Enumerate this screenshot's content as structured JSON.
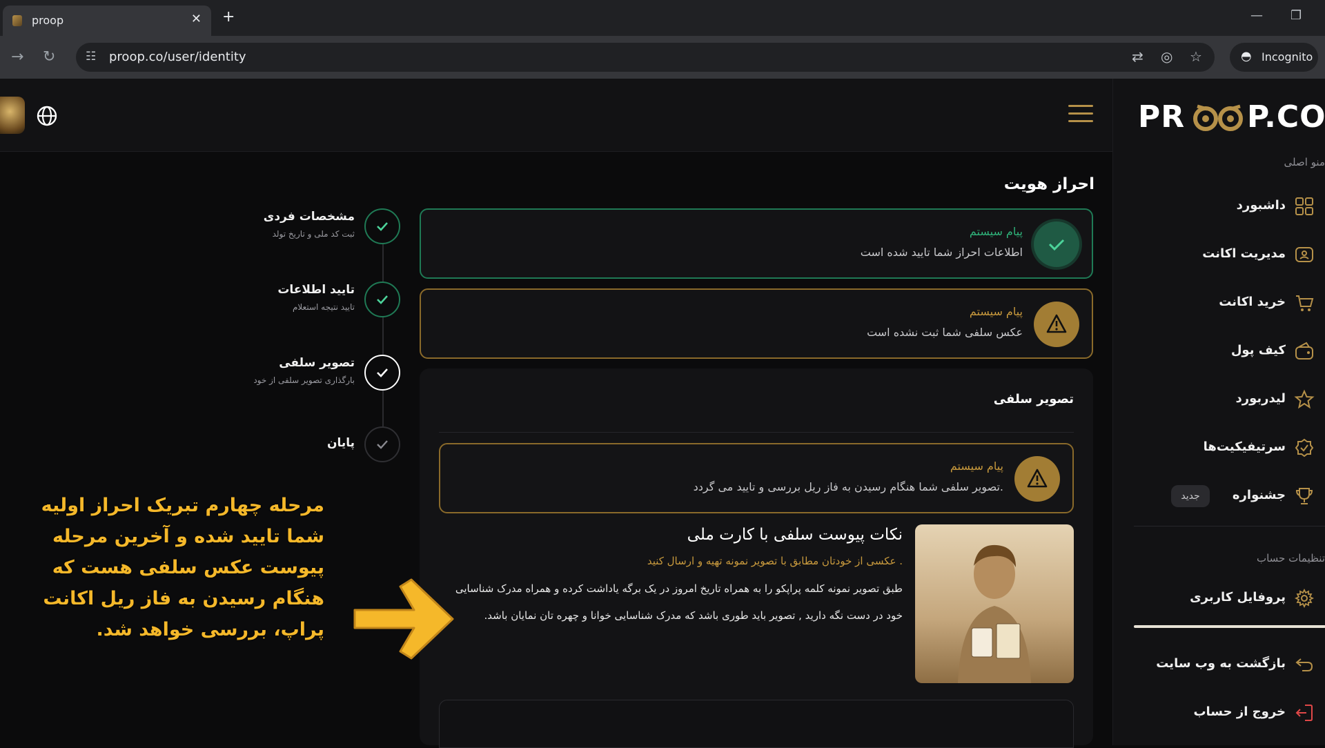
{
  "browser": {
    "tab_title": "proop",
    "tab_close": "✕",
    "new_tab": "+",
    "url": "proop.co/user/identity",
    "incognito_label": "Incognito"
  },
  "header": {
    "logo_left": "PR",
    "logo_right": "P.CO"
  },
  "sidebar": {
    "main_menu_label": "منو اصلی",
    "items": [
      {
        "label": "داشبورد",
        "icon": "grid-icon"
      },
      {
        "label": "مدیریت اکانت",
        "icon": "account-manage-icon"
      },
      {
        "label": "خرید اکانت",
        "icon": "cart-icon"
      },
      {
        "label": "کیف پول",
        "icon": "wallet-icon"
      },
      {
        "label": "لیدربورد",
        "icon": "star-icon"
      },
      {
        "label": "سرتیفیکیت‌ها",
        "icon": "certificate-icon"
      },
      {
        "label": "جشنواره",
        "icon": "trophy-icon",
        "badge": "جدید"
      }
    ],
    "account_settings_label": "تنظیمات حساب",
    "profile_label": "پروفایل کاربری",
    "back_label": "بازگشت به وب سایت",
    "logout_label": "خروج از حساب"
  },
  "main": {
    "page_title": "احراز هویت",
    "alerts": [
      {
        "title": "پیام سیستم",
        "text": "اطلاعات احراز شما تایید شده است",
        "status": "success"
      },
      {
        "title": "پیام سیستم",
        "text": "عکس سلفی شما ثبت نشده است",
        "status": "warning"
      }
    ],
    "selfie": {
      "card_title": "تصویر سلفی",
      "alert_title": "پیام سیستم",
      "alert_text": "تصویر سلفی شما هنگام رسیدن به فاز ریل بررسی و تایید می گردد.",
      "tips_title": "نکات پیوست سلفی با کارت ملی",
      "tips_subtitle": "عکسی از خودتان مطابق با تصویر نمونه تهیه و ارسال کنید .",
      "tips_body": "طبق تصویر نمونه کلمه پراپکو را به همراه تاریخ امروز در یک برگه یاداشت کرده و همراه مدرک شناسایی خود در دست نگه دارید , تصویر باید طوری باشد که مدرک شناسایی خوانا و چهره تان نمایان باشد."
    }
  },
  "stepper": [
    {
      "title": "مشخصات فردی",
      "subtitle": "ثبت کد ملی و تاریخ تولد",
      "state": "done"
    },
    {
      "title": "تایید اطلاعات",
      "subtitle": "تایید نتیجه استعلام",
      "state": "done"
    },
    {
      "title": "تصویر سلفی",
      "subtitle": "بارگذاری تصویر سلفی از خود",
      "state": "active"
    },
    {
      "title": "پایان",
      "subtitle": "",
      "state": "todo"
    }
  ],
  "annotation": {
    "text": "مرحله چهارم تبریک احراز اولیه شما تایید شده و آخرین مرحله پیوست عکس سلفی هست که هنگام رسیدن به فاز ریل اکانت پراپ، بررسی خواهد شد."
  },
  "colors": {
    "accent_gold": "#b69149",
    "success_green": "#2fb37a",
    "annotation_yellow": "#f5b82a"
  }
}
